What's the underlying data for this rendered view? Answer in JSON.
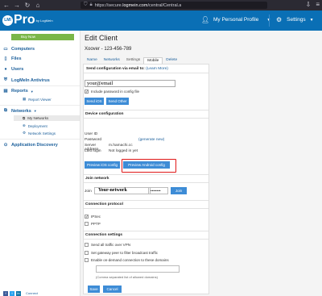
{
  "browser": {
    "url_prefix": "https://secure.",
    "url_host": "logmein.com",
    "url_path": "/central/Central.a"
  },
  "header": {
    "logo_mark": "LMI",
    "logo_pro": "Pro",
    "logo_sub": "by LogMeIn",
    "profile_label": "My Personal Profile",
    "settings_label": "Settings"
  },
  "sidebar": {
    "buy_now": "Buy Now",
    "items": [
      {
        "label": "Computers",
        "icon": "monitor-icon"
      },
      {
        "label": "Files",
        "icon": "file-icon"
      },
      {
        "label": "Users",
        "icon": "user-icon"
      },
      {
        "label": "LogMeIn Antivirus",
        "icon": "antivirus-icon"
      },
      {
        "label": "Reports",
        "icon": "reports-icon"
      },
      {
        "label": "Networks",
        "icon": "network-icon"
      },
      {
        "label": "Application Discovery",
        "icon": "discovery-icon"
      }
    ],
    "subitems": {
      "report_viewer": "Report Viewer",
      "my_networks": "My Networks",
      "deployment": "Deployment",
      "network_settings": "Network Settings"
    },
    "footer_text": "Connect"
  },
  "main": {
    "title": "Edit Client",
    "client_name": "Xoover - 123-456-789",
    "tabs": [
      "Name",
      "Networks",
      "Settings",
      "Mobile",
      "Delete"
    ],
    "active_tab": "Mobile",
    "send_section": {
      "title": "Send configuration via email to:",
      "learn_more": "(Learn More)",
      "email_value": "your@email",
      "include_password": "Include password in config file",
      "send_ios": "Send iOS",
      "send_other": "Send Other"
    },
    "device_section": {
      "title": "Device configuration",
      "user_id_label": "User ID",
      "password_label": "Password",
      "generate_new": "(generate new)",
      "server_label": "Server address",
      "server_value": "m.hamachi.cc",
      "last_login_label": "Last login",
      "last_login_value": "Not logged in yet",
      "preview_ios": "Preview iOS config",
      "preview_android": "Preview Android config"
    },
    "join_section": {
      "title": "Join network",
      "join_label": "Join",
      "network_value": "Your-network",
      "password_mask": "••••••••",
      "join_button": "Join"
    },
    "protocol_section": {
      "title": "Connection protocol",
      "ipsec": "IPSec",
      "pptp": "PPTP"
    },
    "conn_section": {
      "title": "Connection settings",
      "opt1": "Send all traffic over VPN",
      "opt2": "Set gateway peer to filter broadcast traffic",
      "opt3": "Enable on-demand connection to these domains",
      "hint": "(Comma separated list of allowed domains)"
    },
    "save": "Save",
    "cancel": "Cancel"
  }
}
